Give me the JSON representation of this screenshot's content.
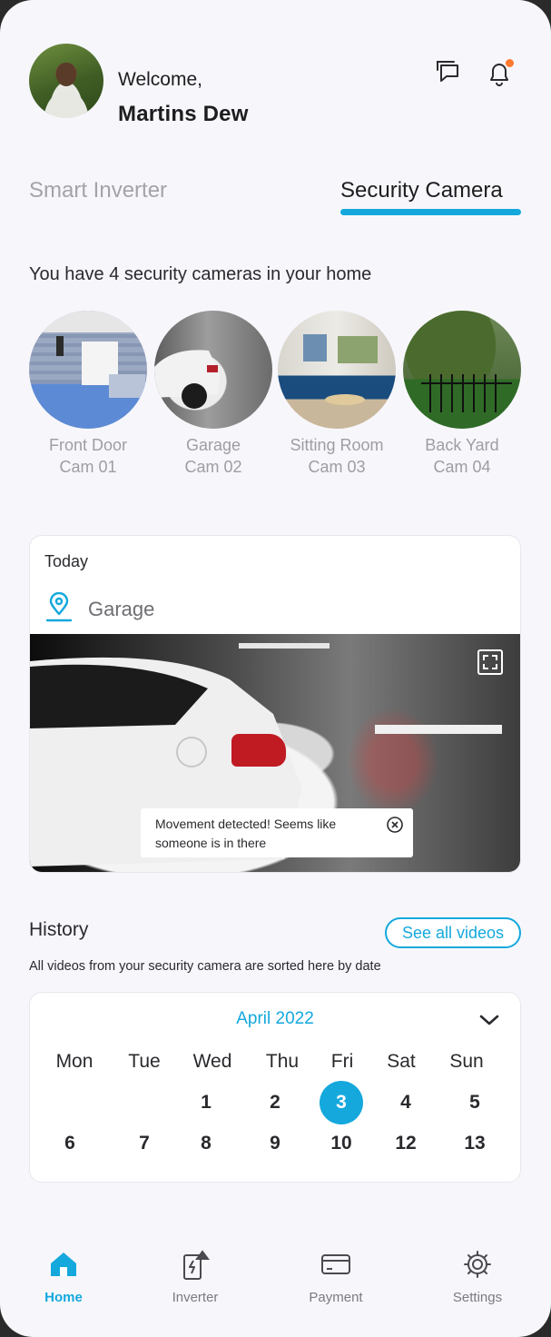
{
  "header": {
    "welcome": "Welcome,",
    "user_name": "Martins Dew",
    "icons": {
      "chat": "chat-icon",
      "bell": "bell-icon"
    },
    "notification_dot_color": "#ff7a2f"
  },
  "tabs": [
    {
      "label": "Smart Inverter",
      "active": false
    },
    {
      "label": "Security Camera",
      "active": true
    }
  ],
  "accent_color": "#14a8dd",
  "cameras_intro": "You have 4 security cameras in your home",
  "cameras": [
    {
      "name": "Front Door",
      "id": "Cam 01"
    },
    {
      "name": "Garage",
      "id": "Cam 02"
    },
    {
      "name": "Sitting Room",
      "id": "Cam 03"
    },
    {
      "name": "Back Yard",
      "id": "Cam 04"
    }
  ],
  "today": {
    "label": "Today",
    "location": "Garage",
    "alert": "Movement detected! Seems like someone is in there"
  },
  "history": {
    "title": "History",
    "see_all": "See all videos",
    "subtitle": "All videos from your security camera are sorted here by date"
  },
  "calendar": {
    "month": "April 2022",
    "weekdays": [
      "Mon",
      "Tue",
      "Wed",
      "Thu",
      "Fri",
      "Sat",
      "Sun"
    ],
    "week1": [
      "",
      "",
      "1",
      "2",
      "3",
      "4",
      "5"
    ],
    "week2": [
      "6",
      "7",
      "8",
      "9",
      "10",
      "12",
      "13"
    ],
    "selected_day": "3"
  },
  "nav": [
    {
      "label": "Home",
      "icon": "home-icon",
      "active": true
    },
    {
      "label": "Inverter",
      "icon": "inverter-icon",
      "active": false
    },
    {
      "label": "Payment",
      "icon": "card-icon",
      "active": false
    },
    {
      "label": "Settings",
      "icon": "gear-icon",
      "active": false
    }
  ]
}
